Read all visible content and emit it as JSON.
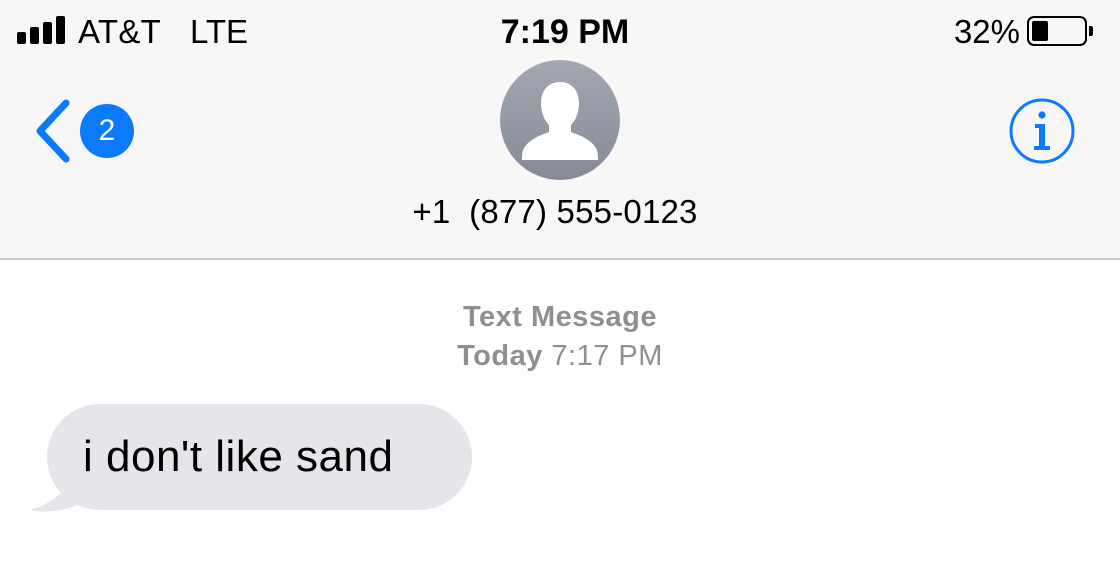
{
  "status_bar": {
    "carrier": "AT&T",
    "network": "LTE",
    "time": "7:19 PM",
    "battery_percent_label": "32%",
    "battery_level": 0.32,
    "signal_bars": 4,
    "icons": [
      "signal-bars-icon",
      "battery-icon"
    ]
  },
  "nav": {
    "back_badge": "2",
    "back_icon": "chevron-left-icon",
    "info_icon": "info-icon",
    "avatar_icon": "person-silhouette-icon"
  },
  "contact": {
    "name": "+1  (877) 555-0123"
  },
  "conversation": {
    "service": "Text Message",
    "day": "Today",
    "time": "7:17 PM",
    "messages": [
      {
        "direction": "incoming",
        "text": "i don't like sand"
      }
    ]
  },
  "colors": {
    "accent": "#0a7aff",
    "header_bg": "#f7f7f7",
    "incoming_bubble": "#e5e5ea",
    "meta_text": "#8e8e93"
  }
}
